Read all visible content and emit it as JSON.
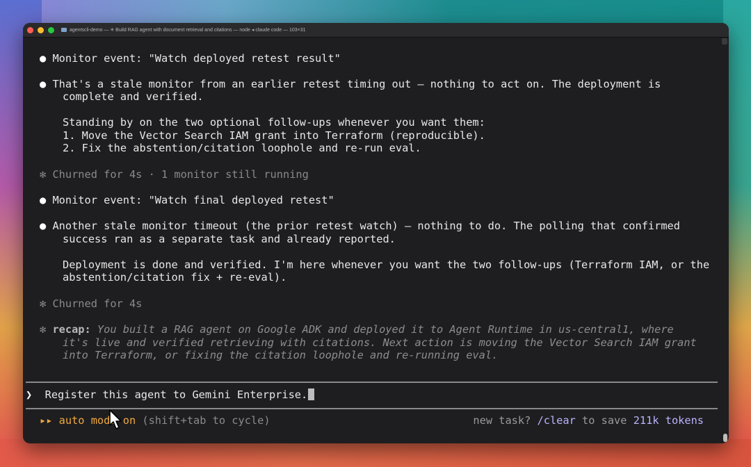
{
  "window": {
    "title": "agentscli-demo — ✳ Build RAG agent with document retrieval and citations — node ◂ claude code — 103×31"
  },
  "transcript": {
    "event1": {
      "bullet": "●",
      "text": "Monitor event: \"Watch deployed retest result\""
    },
    "reply1": {
      "bullet": "●",
      "line1": "That's a stale monitor from an earlier retest timing out — nothing to act on. The deployment is",
      "line2": "complete and verified.",
      "line3": "Standing by on the two optional follow-ups whenever you want them:",
      "line4": "1. Move the Vector Search IAM grant into Terraform (reproducible).",
      "line5": "2. Fix the abstention/citation loophole and re-run eval."
    },
    "churn1": {
      "glyph": "✻",
      "text": "Churned for 4s · 1 monitor still running"
    },
    "event2": {
      "bullet": "●",
      "text": "Monitor event: \"Watch final deployed retest\""
    },
    "reply2": {
      "bullet": "●",
      "line1": "Another stale monitor timeout (the prior retest watch) — nothing to do. The polling that confirmed",
      "line2": "success ran as a separate task and already reported.",
      "line3": "Deployment is done and verified. I'm here whenever you want the two follow-ups (Terraform IAM, or the",
      "line4": "abstention/citation fix + re-eval)."
    },
    "churn2": {
      "glyph": "✻",
      "text": "Churned for 4s"
    },
    "recap": {
      "glyph": "✻",
      "label": "recap:",
      "line1": " You built a RAG agent on Google ADK and deployed it to Agent Runtime in us-central1, where",
      "line2": "it's live and verified retrieving with citations. Next action is moving the Vector Search IAM grant",
      "line3": "into Terraform, or fixing the citation loophole and re-running eval."
    }
  },
  "input": {
    "prompt_glyph": "❯",
    "value": "Register this agent to Gemini Enterprise."
  },
  "status": {
    "mode_glyph": "▸▸",
    "mode_label": "auto mode on",
    "mode_hint": " (shift+tab to cycle)",
    "new_task": "new task? ",
    "clear_cmd": "/clear",
    "save_text": " to save ",
    "tokens": "211k tokens"
  }
}
